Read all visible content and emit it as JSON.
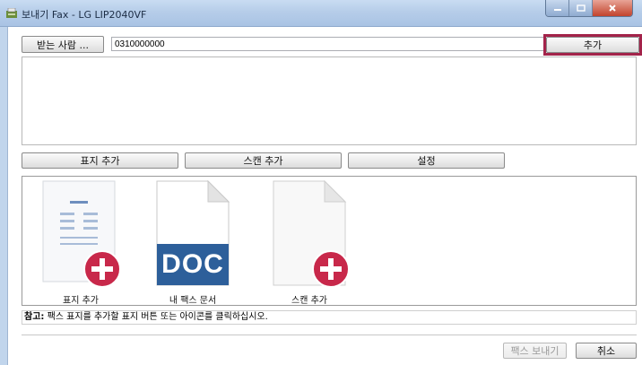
{
  "window": {
    "title": "보내기 Fax - LG LIP2040VF"
  },
  "recipient": {
    "button_label": "받는 사람 ...",
    "value": "0310000000",
    "add_label": "추가"
  },
  "toolbar": {
    "cover_label": "표지 추가",
    "scan_label": "스캔 추가",
    "settings_label": "설정"
  },
  "documents": [
    {
      "label": "표지 추가",
      "icon": "cover-page-add-icon"
    },
    {
      "label": "내 팩스 문서",
      "icon": "doc-file-icon",
      "badge": "DOC"
    },
    {
      "label": "스캔 추가",
      "icon": "scan-add-icon"
    }
  ],
  "note": {
    "prefix": "참고:",
    "text": " 팩스 표지를 추가할 표지 버튼 또는 아이콘를 클릭하십시오."
  },
  "footer": {
    "send_label": "팩스 보내기",
    "cancel_label": "취소"
  },
  "colors": {
    "highlight": "#a3234a",
    "plus_badge": "#c8284a",
    "doc_blue": "#2d5f9a"
  }
}
